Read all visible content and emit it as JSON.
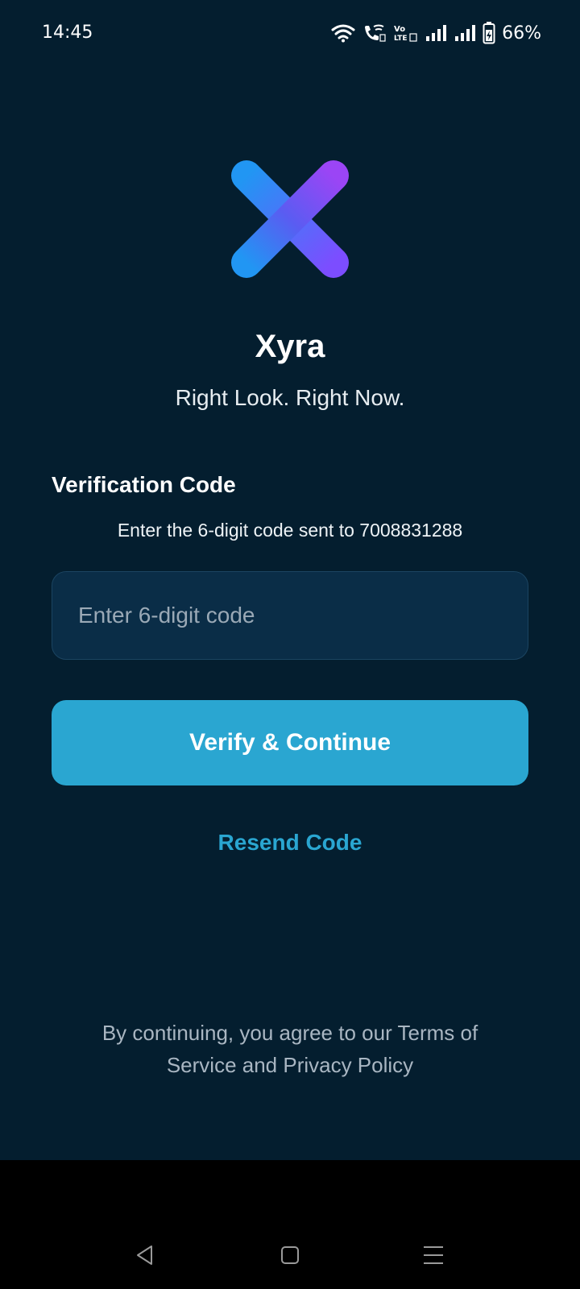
{
  "status_bar": {
    "time": "14:45",
    "battery": "66%",
    "icons": [
      "wifi-icon",
      "wifi-calling-icon",
      "volte-icon",
      "signal-sim1-icon",
      "signal-sim2-icon",
      "battery-icon"
    ],
    "volte_label": "Vo LTE"
  },
  "brand": {
    "name": "Xyra",
    "tagline": "Right Look. Right Now.",
    "logo_icon": "x-logo-icon",
    "logo_colors": [
      "#2196f3",
      "#8a3ff0"
    ]
  },
  "verification": {
    "title": "Verification Code",
    "instruction": "Enter the 6-digit code sent to 7008831288",
    "input_placeholder": "Enter 6-digit code",
    "input_value": "",
    "verify_label": "Verify & Continue",
    "resend_label": "Resend Code"
  },
  "footer": {
    "terms": "By continuing, you agree to our Terms of Service and Privacy Policy"
  },
  "navigation": {
    "back_icon": "back-triangle-icon",
    "home_icon": "home-square-icon",
    "menu_icon": "menu-lines-icon"
  },
  "colors": {
    "background": "#041e2f",
    "accent": "#2aa6d1",
    "input_bg": "#0a2d47"
  }
}
